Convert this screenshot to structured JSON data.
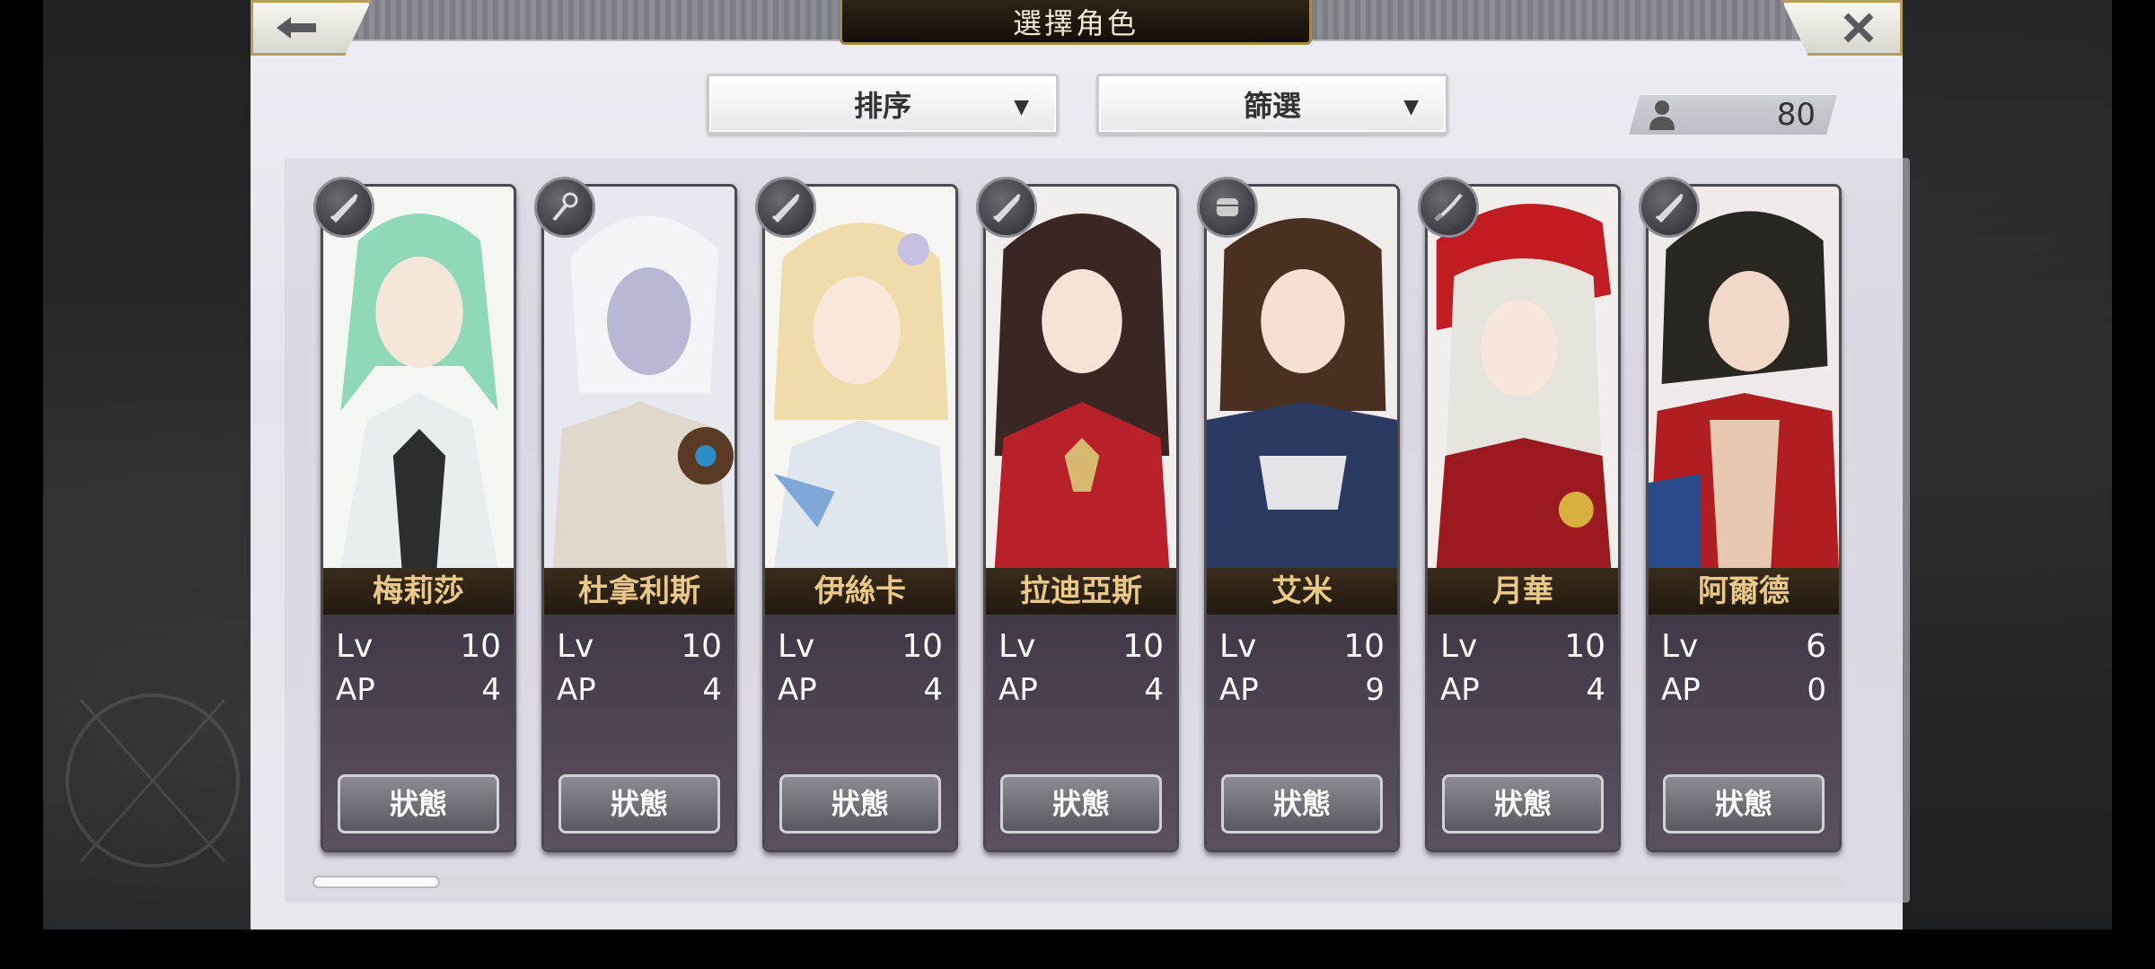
{
  "header": {
    "title": "選擇角色",
    "back_icon": "arrow-left-icon",
    "close_icon": "close-icon"
  },
  "controls": {
    "sort_label": "排序",
    "filter_label": "篩選",
    "character_count": "80"
  },
  "characters": [
    {
      "name": "梅莉莎",
      "lv_label": "Lv",
      "lv": "10",
      "ap_label": "AP",
      "ap": "4",
      "status_label": "狀態",
      "class_icon": "sword-icon"
    },
    {
      "name": "杜拿利斯",
      "lv_label": "Lv",
      "lv": "10",
      "ap_label": "AP",
      "ap": "4",
      "status_label": "狀態",
      "class_icon": "staff-icon"
    },
    {
      "name": "伊絲卡",
      "lv_label": "Lv",
      "lv": "10",
      "ap_label": "AP",
      "ap": "4",
      "status_label": "狀態",
      "class_icon": "sword-icon"
    },
    {
      "name": "拉迪亞斯",
      "lv_label": "Lv",
      "lv": "10",
      "ap_label": "AP",
      "ap": "4",
      "status_label": "狀態",
      "class_icon": "sword-icon"
    },
    {
      "name": "艾米",
      "lv_label": "Lv",
      "lv": "10",
      "ap_label": "AP",
      "ap": "9",
      "status_label": "狀態",
      "class_icon": "fist-icon"
    },
    {
      "name": "月華",
      "lv_label": "Lv",
      "lv": "10",
      "ap_label": "AP",
      "ap": "4",
      "status_label": "狀態",
      "class_icon": "katana-icon"
    },
    {
      "name": "阿爾德",
      "lv_label": "Lv",
      "lv": "6",
      "ap_label": "AP",
      "ap": "0",
      "status_label": "狀態",
      "class_icon": "sword-icon"
    }
  ],
  "colors": {
    "name_text": "#e8c98a",
    "accent_gold": "#b99c5a"
  }
}
